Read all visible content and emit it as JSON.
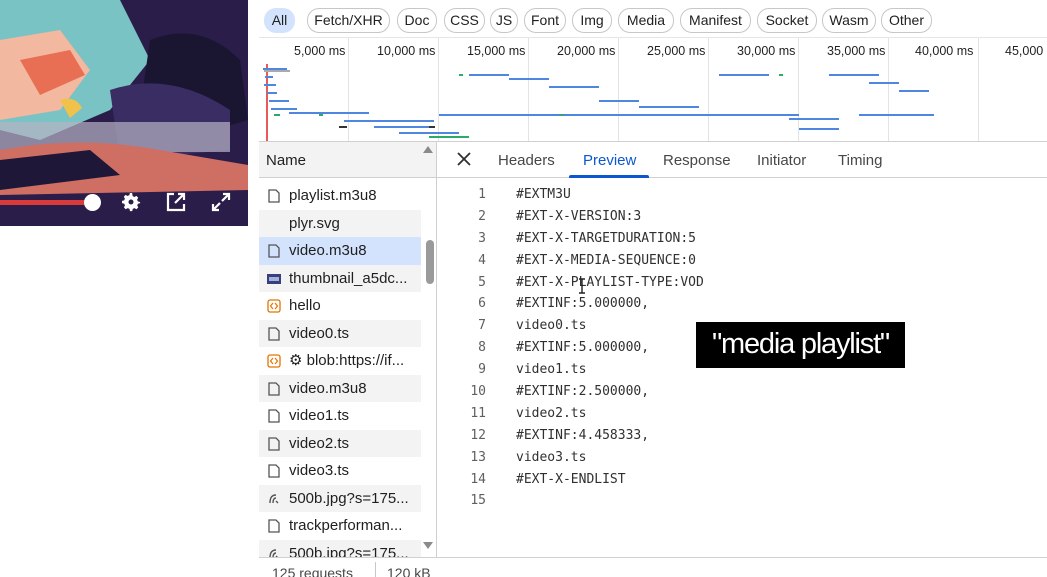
{
  "player": {
    "controls": [
      "settings-gear-icon",
      "external-open-icon",
      "fullscreen-icon"
    ],
    "progress_fraction": 0.37,
    "colors": {
      "progress": "#d93a3a",
      "background": "#2b1d4a"
    }
  },
  "filters": {
    "items": [
      "All",
      "Fetch/XHR",
      "Doc",
      "CSS",
      "JS",
      "Font",
      "Img",
      "Media",
      "Manifest",
      "Socket",
      "Wasm",
      "Other"
    ],
    "active": "All"
  },
  "timeline": {
    "ticks": [
      "5,000 ms",
      "10,000 ms",
      "15,000 ms",
      "20,000 ms",
      "25,000 ms",
      "30,000 ms",
      "35,000 ms",
      "40,000 ms",
      "45,000"
    ]
  },
  "requests": {
    "header": "Name",
    "rows": [
      {
        "name": "playlist.m3u8",
        "icon": "document-icon"
      },
      {
        "name": "plyr.svg",
        "icon": "none"
      },
      {
        "name": "video.m3u8",
        "icon": "document-icon",
        "selected": true
      },
      {
        "name": "thumbnail_a5dc...",
        "icon": "image-icon"
      },
      {
        "name": "hello",
        "icon": "script-icon"
      },
      {
        "name": "video0.ts",
        "icon": "document-icon"
      },
      {
        "name": "⚙ blob:https://if...",
        "icon": "script-icon"
      },
      {
        "name": "video.m3u8",
        "icon": "document-icon"
      },
      {
        "name": "video1.ts",
        "icon": "document-icon"
      },
      {
        "name": "video2.ts",
        "icon": "document-icon"
      },
      {
        "name": "video3.ts",
        "icon": "document-icon"
      },
      {
        "name": "500b.jpg?s=175...",
        "icon": "ping-icon"
      },
      {
        "name": "trackperforman...",
        "icon": "document-icon"
      },
      {
        "name": "500b.jpg?s=175...",
        "icon": "ping-icon"
      }
    ]
  },
  "detail": {
    "tabs": [
      "Headers",
      "Preview",
      "Response",
      "Initiator",
      "Timing"
    ],
    "active_tab": "Preview",
    "lines": [
      "#EXTM3U",
      "#EXT-X-VERSION:3",
      "#EXT-X-TARGETDURATION:5",
      "#EXT-X-MEDIA-SEQUENCE:0",
      "#EXT-X-PLAYLIST-TYPE:VOD",
      "#EXTINF:5.000000,",
      "video0.ts",
      "#EXTINF:5.000000,",
      "video1.ts",
      "#EXTINF:2.500000,",
      "video2.ts",
      "#EXTINF:4.458333,",
      "video3.ts",
      "#EXT-X-ENDLIST",
      ""
    ],
    "caption": "\"media playlist\""
  },
  "status": {
    "requests": "125 requests",
    "transferred": "120 kB"
  }
}
